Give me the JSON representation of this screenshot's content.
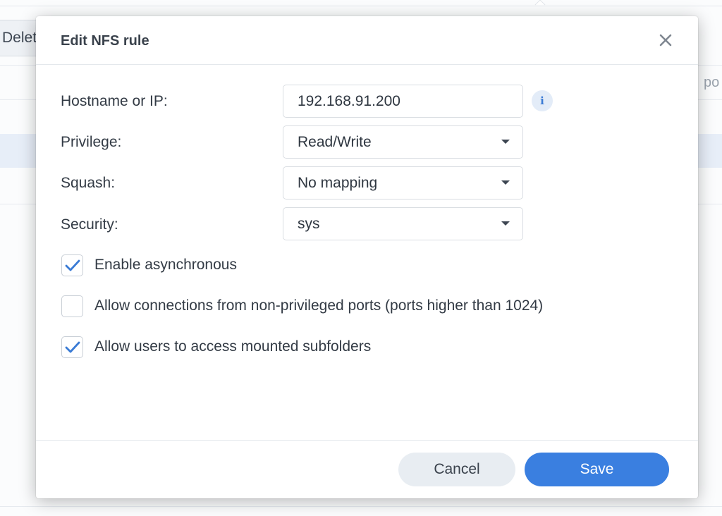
{
  "background": {
    "delete_button_label": "Delete",
    "right_partial_text": "po"
  },
  "dialog": {
    "title": "Edit NFS rule",
    "close_icon": "close-icon",
    "fields": {
      "hostname": {
        "label": "Hostname or IP:",
        "value": "192.168.91.200",
        "info_icon": "info-icon"
      },
      "privilege": {
        "label": "Privilege:",
        "value": "Read/Write"
      },
      "squash": {
        "label": "Squash:",
        "value": "No mapping"
      },
      "security": {
        "label": "Security:",
        "value": "sys"
      }
    },
    "checkboxes": [
      {
        "label": "Enable asynchronous",
        "checked": true
      },
      {
        "label": "Allow connections from non-privileged ports (ports higher than 1024)",
        "checked": false
      },
      {
        "label": "Allow users to access mounted subfolders",
        "checked": true
      }
    ],
    "buttons": {
      "cancel": "Cancel",
      "save": "Save"
    }
  },
  "colors": {
    "accent": "#3a7fe0",
    "checkmark": "#3a7bd5"
  }
}
